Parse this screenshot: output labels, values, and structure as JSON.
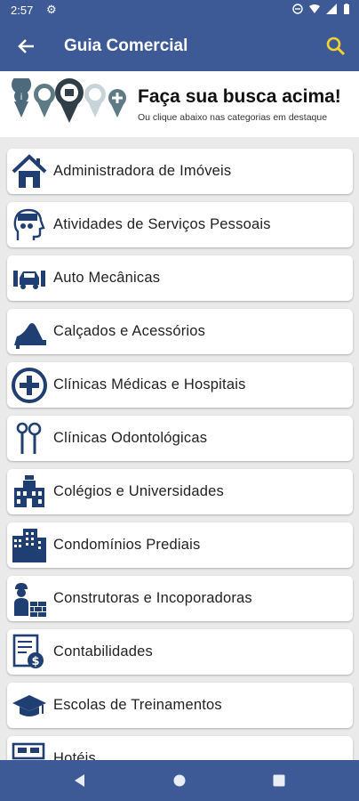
{
  "status": {
    "time": "2:57"
  },
  "app_bar": {
    "title": "Guia Comercial"
  },
  "banner": {
    "headline": "Faça sua busca acima!",
    "subtitle": "Ou clique abaixo nas categorias em destaque"
  },
  "categories": [
    {
      "label": "Administradora de Imóveis",
      "icon": "house-icon"
    },
    {
      "label": "Atividades de Serviços Pessoais",
      "icon": "head-gears-icon"
    },
    {
      "label": "Auto Mecânicas",
      "icon": "car-mechanic-icon"
    },
    {
      "label": "Calçados e Acessórios",
      "icon": "high-heel-icon"
    },
    {
      "label": "Clínicas Médicas e Hospitais",
      "icon": "medical-cross-icon"
    },
    {
      "label": "Clínicas Odontológicas",
      "icon": "dental-tools-icon"
    },
    {
      "label": "Colégios e Universidades",
      "icon": "university-icon"
    },
    {
      "label": "Condomínios Prediais",
      "icon": "buildings-icon"
    },
    {
      "label": "Construtoras e Incoporadoras",
      "icon": "builder-icon"
    },
    {
      "label": "Contabilidades",
      "icon": "accounting-icon"
    },
    {
      "label": "Escolas de Treinamentos",
      "icon": "graduation-cap-icon"
    },
    {
      "label": "Hotéis",
      "icon": "hotel-icon"
    }
  ],
  "colors": {
    "primary": "#3d5a97",
    "icon_blue": "#1f3f73",
    "search_yellow": "#f2d22e"
  }
}
